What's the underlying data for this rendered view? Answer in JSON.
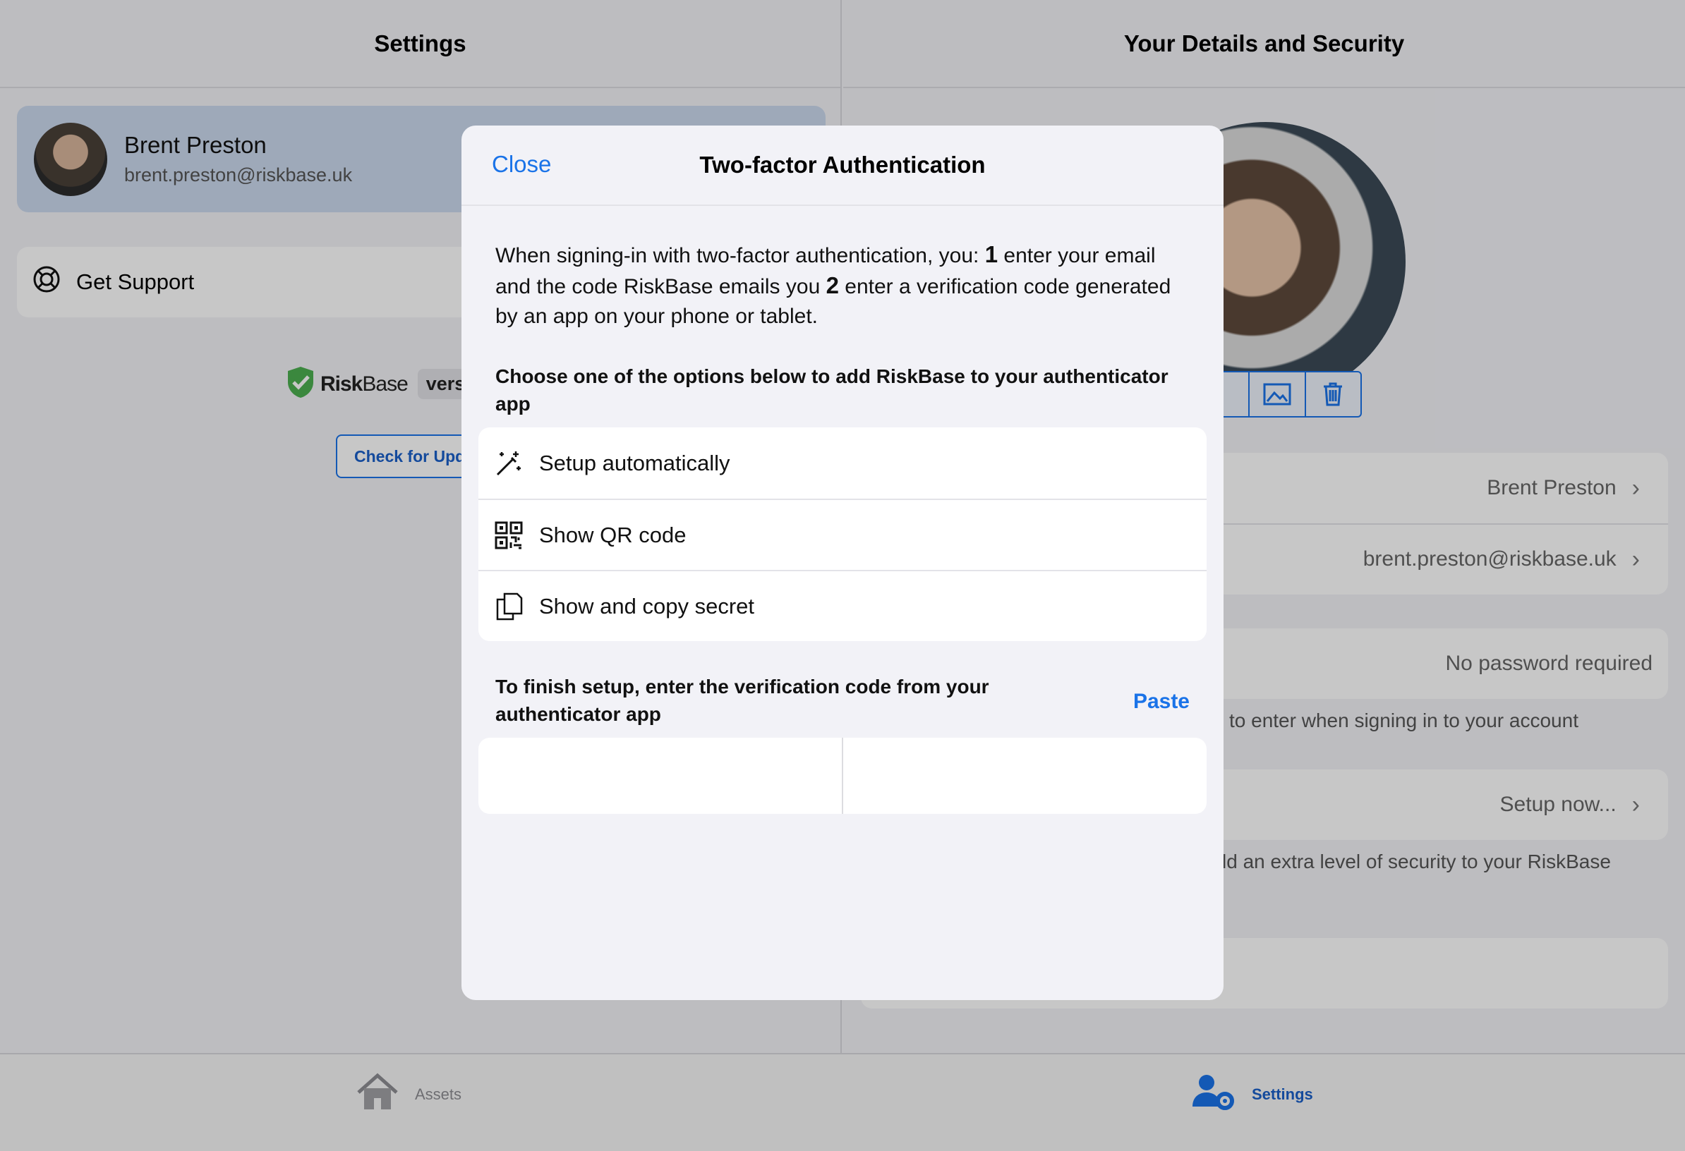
{
  "left_pane": {
    "title": "Settings",
    "profile": {
      "name": "Brent Preston",
      "email": "brent.preston@riskbase.uk"
    },
    "support_label": "Get Support",
    "brand": {
      "name_bold": "Risk",
      "name_rest": "Base",
      "version_label": "versi"
    },
    "update_button": "Check for Upd"
  },
  "right_pane": {
    "title": "Your Details and Security",
    "name_value": "Brent Preston",
    "email_value": "brent.preston@riskbase.uk",
    "password_value": "No password required",
    "password_footer": "to enter when signing in to your account",
    "tfa_value": "Setup now...",
    "tfa_footer": "ld an extra level of security to your RiskBase"
  },
  "tabbar": {
    "assets_label": "Assets",
    "settings_label": "Settings"
  },
  "modal": {
    "close_label": "Close",
    "title": "Two-factor Authentication",
    "intro_part1": "When signing-in with two-factor authentication, you: ",
    "intro_num1": "1",
    "intro_part2": " enter your email and the code RiskBase emails you ",
    "intro_num2": "2",
    "intro_part3": " enter a verification code generated by an app on your phone or tablet.",
    "choose_text": "Choose one of the options below to add RiskBase to your authenticator app",
    "options": [
      {
        "icon": "magic-wand-icon",
        "label": "Setup automatically"
      },
      {
        "icon": "qr-code-icon",
        "label": "Show QR code"
      },
      {
        "icon": "copy-icon",
        "label": "Show and copy secret"
      }
    ],
    "finish_text": "To finish setup, enter the verification code from your authenticator app",
    "paste_label": "Paste",
    "code_digits": [
      "",
      "",
      "",
      "",
      "",
      ""
    ]
  },
  "colors": {
    "accent": "#1a73e8",
    "brand_green": "#4caf50"
  }
}
